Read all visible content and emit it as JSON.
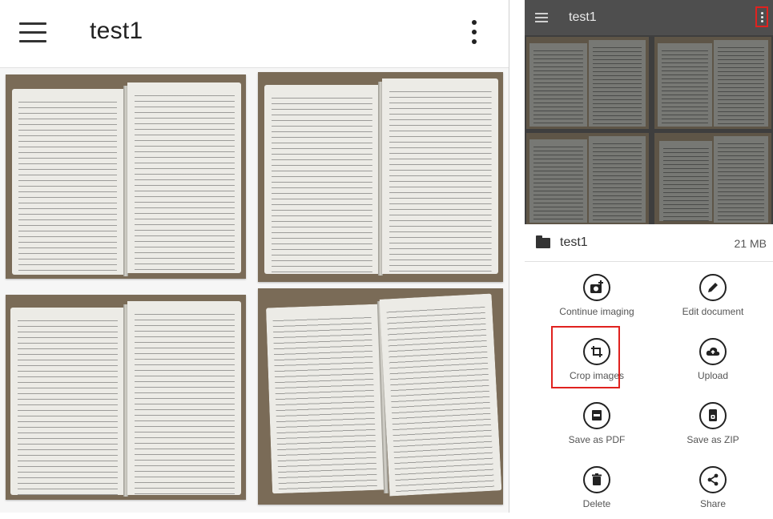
{
  "left_app_bar": {
    "title": "test1",
    "menu_icon": "hamburger-icon",
    "overflow_icon": "more-vert-icon"
  },
  "right_app_bar": {
    "title": "test1",
    "menu_icon": "hamburger-icon",
    "overflow_icon": "more-vert-icon"
  },
  "document": {
    "name": "test1",
    "size": "21 MB",
    "icon": "folder-icon"
  },
  "actions": [
    {
      "label": "Continue imaging",
      "icon": "camera-add-icon"
    },
    {
      "label": "Edit document",
      "icon": "pencil-icon"
    },
    {
      "label": "Crop images",
      "icon": "crop-icon",
      "highlighted": true
    },
    {
      "label": "Upload",
      "icon": "cloud-upload-icon"
    },
    {
      "label": "Save as PDF",
      "icon": "pdf-icon"
    },
    {
      "label": "Save as ZIP",
      "icon": "zip-icon"
    },
    {
      "label": "Delete",
      "icon": "trash-icon"
    },
    {
      "label": "Share",
      "icon": "share-icon"
    }
  ],
  "colors": {
    "highlight": "#e0221f",
    "right_app_bar": "#4e4e4e",
    "icon_stroke": "#222222"
  }
}
